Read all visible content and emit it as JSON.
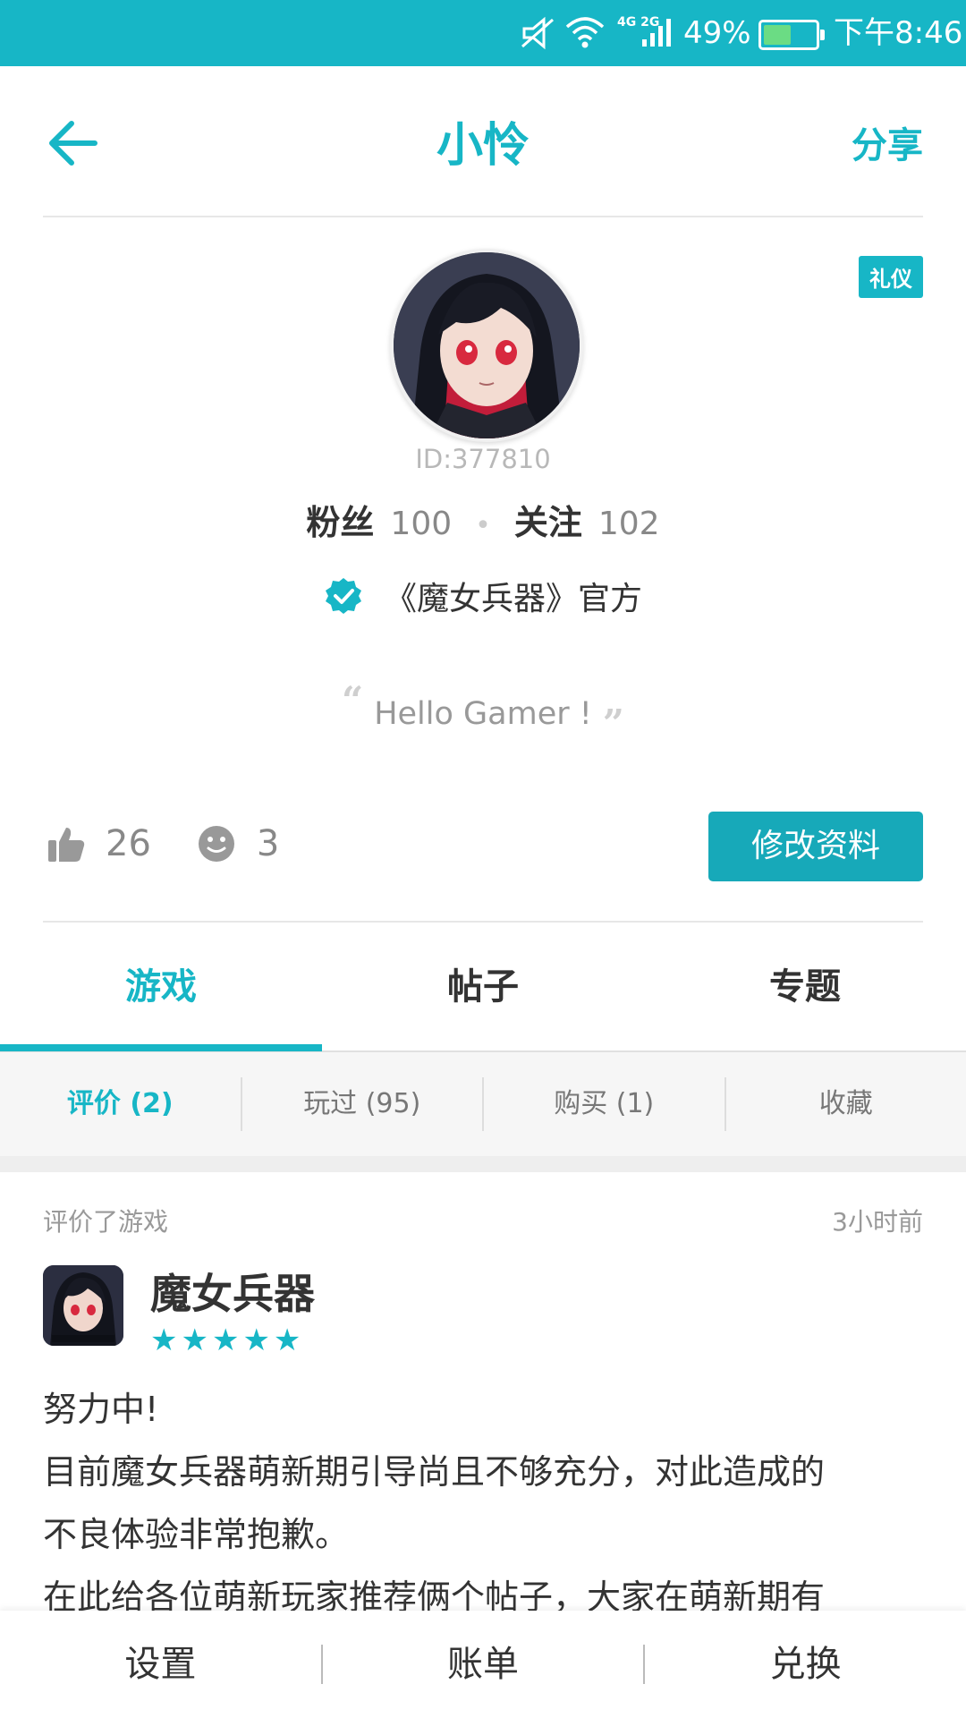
{
  "status": {
    "battery": "49%",
    "time": "下午8:46",
    "network": "4G 2G"
  },
  "header": {
    "title": "小怜",
    "share_label": "分享"
  },
  "profile": {
    "badge": "礼仪",
    "id_text": "ID:377810",
    "fans_label": "粉丝",
    "fans_count": "100",
    "follow_label": "关注",
    "follow_count": "102",
    "verified_text": "《魔女兵器》官方",
    "motto": "Hello Gamer !",
    "likes": "26",
    "faces": "3",
    "edit_label": "修改资料"
  },
  "tabs": [
    "游戏",
    "帖子",
    "专题"
  ],
  "subtabs": [
    "评价 (2)",
    "玩过 (95)",
    "购买 (1)",
    "收藏"
  ],
  "review": {
    "action": "评价了游戏",
    "time": "3小时前",
    "game": "魔女兵器",
    "rating": 5,
    "stars": "★★★★★",
    "lines": [
      "努力中!",
      "目前魔女兵器萌新期引导尚且不够充分，对此造成的",
      "不良体验非常抱歉。",
      "在此给各位萌新玩家推荐俩个帖子，大家在萌新期有"
    ]
  },
  "bottom": [
    "设置",
    "账单",
    "兑换"
  ],
  "colors": {
    "accent": "#17b6c6",
    "button": "#17a9b9"
  }
}
